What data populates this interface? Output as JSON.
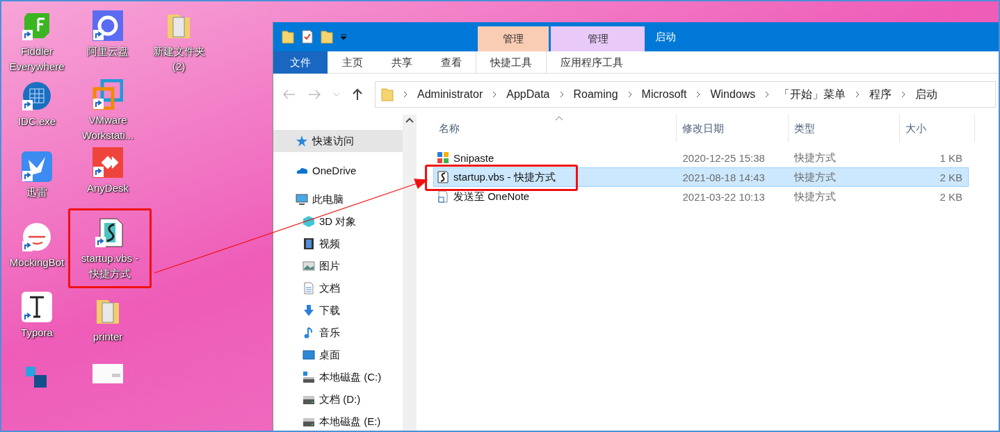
{
  "desktop": {
    "columns": [
      [
        {
          "label": "Fiddler Everywhere",
          "kind": "fiddler",
          "marked": false
        },
        {
          "label": "IDC.exe",
          "kind": "globe",
          "marked": false
        },
        {
          "label": "迅雷",
          "kind": "bird",
          "marked": false
        },
        {
          "label": "MockingBot",
          "kind": "mock",
          "marked": false
        },
        {
          "label": "Typora",
          "kind": "typora",
          "marked": false
        },
        {
          "kind": "squares",
          "marked": false
        }
      ],
      [
        {
          "label": "阿里云盘",
          "kind": "cloud",
          "marked": false
        },
        {
          "label": "VMware Workstati...",
          "kind": "vmware",
          "marked": false
        },
        {
          "label": "AnyDesk",
          "kind": "anydesk",
          "marked": false
        },
        {
          "label": "startup.vbs - 快捷方式",
          "kind": "script",
          "marked": true
        },
        {
          "label": "printer",
          "kind": "folder",
          "marked": false
        },
        {
          "kind": "thumb",
          "marked": false
        }
      ],
      [
        {
          "label": "新建文件夹 (2)",
          "kind": "folder",
          "marked": false
        }
      ]
    ]
  },
  "window": {
    "title": "启动",
    "context_tabs": [
      {
        "label": "管理",
        "color": "#f9cdb4"
      },
      {
        "label": "管理",
        "color": "#e8c9f7"
      }
    ],
    "ribbon_tabs": [
      {
        "label": "文件",
        "kind": "file"
      },
      {
        "label": "主页",
        "kind": "plain"
      },
      {
        "label": "共享",
        "kind": "plain"
      },
      {
        "label": "查看",
        "kind": "plain"
      },
      {
        "label": "快捷工具",
        "kind": "context"
      },
      {
        "label": "应用程序工具",
        "kind": "context"
      }
    ],
    "breadcrumb": [
      "Administrator",
      "AppData",
      "Roaming",
      "Microsoft",
      "Windows",
      "「开始」菜单",
      "程序",
      "启动"
    ],
    "nav_pane": [
      {
        "label": "快速访问",
        "kind": "star",
        "selected": true
      },
      {
        "label": "OneDrive",
        "kind": "onedrive",
        "selected": false
      },
      {
        "label": "此电脑",
        "kind": "pc",
        "selected": false,
        "children": [
          {
            "label": "3D 对象",
            "kind": "cube",
            "selected": false
          },
          {
            "label": "视频",
            "kind": "video",
            "selected": false
          },
          {
            "label": "图片",
            "kind": "picture",
            "selected": false
          },
          {
            "label": "文档",
            "kind": "doc",
            "selected": false
          },
          {
            "label": "下载",
            "kind": "download",
            "selected": false
          },
          {
            "label": "音乐",
            "kind": "music",
            "selected": false
          },
          {
            "label": "桌面",
            "kind": "desktop",
            "selected": false
          },
          {
            "label": "本地磁盘 (C:)",
            "kind": "sysdrive",
            "selected": false
          },
          {
            "label": "文档 (D:)",
            "kind": "drive",
            "selected": false
          },
          {
            "label": "本地磁盘 (E:)",
            "kind": "drive",
            "selected": false
          }
        ]
      }
    ],
    "columns": [
      {
        "label": "名称",
        "sorted": true
      },
      {
        "label": "修改日期",
        "sorted": false
      },
      {
        "label": "类型",
        "sorted": false
      },
      {
        "label": "大小",
        "sorted": false
      }
    ],
    "files": [
      {
        "name": "Snipaste",
        "date": "2020-12-25 15:38",
        "type": "快捷方式",
        "size": "1 KB",
        "kind": "snipaste",
        "selected": false,
        "marked": false
      },
      {
        "name": "startup.vbs - 快捷方式",
        "date": "2021-08-18 14:43",
        "type": "快捷方式",
        "size": "2 KB",
        "kind": "script",
        "selected": true,
        "marked": true
      },
      {
        "name": "发送至 OneNote",
        "date": "2021-03-22 10:13",
        "type": "快捷方式",
        "size": "2 KB",
        "kind": "blank",
        "selected": false,
        "marked": false
      }
    ]
  }
}
